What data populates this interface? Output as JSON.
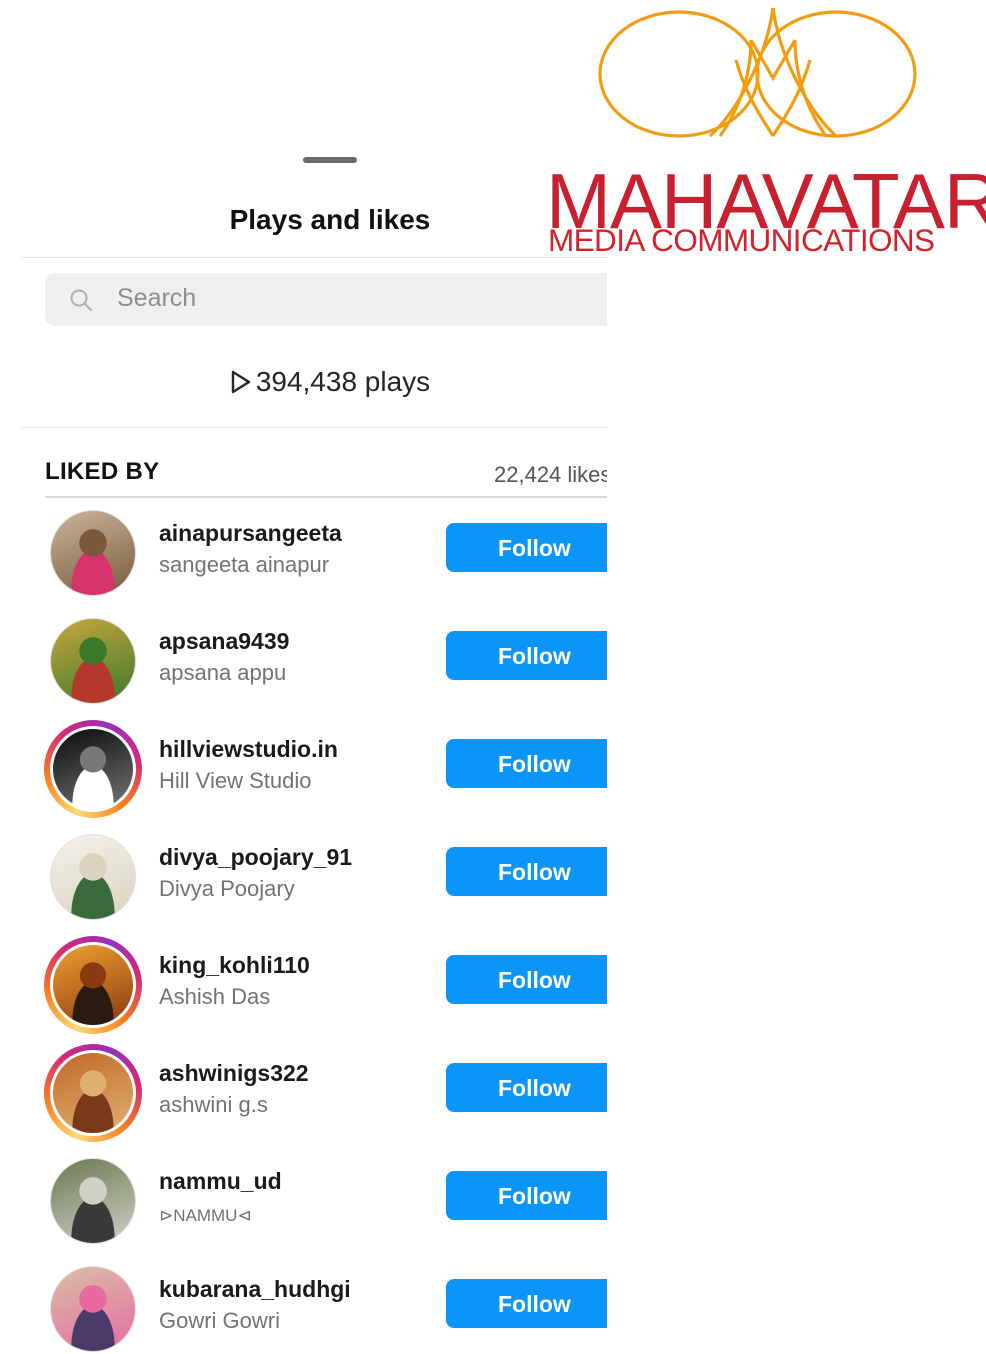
{
  "sheet": {
    "title": "Plays and likes",
    "search_placeholder": "Search",
    "plays_text": "394,438 plays",
    "liked_by_label": "LIKED BY",
    "likes_count": "22,424 likes"
  },
  "users": [
    {
      "username": "ainapursangeeta",
      "fullname": "sangeeta ainapur",
      "button": "Follow",
      "story_ring": false,
      "avatar_colors": [
        "#c9b49a",
        "#7a5a3c",
        "#d6336c"
      ]
    },
    {
      "username": "apsana9439",
      "fullname": "apsana appu",
      "button": "Follow",
      "story_ring": false,
      "avatar_colors": [
        "#c8a640",
        "#3b7a2a",
        "#b33a2a"
      ]
    },
    {
      "username": "hillviewstudio.in",
      "fullname": "Hill View Studio",
      "button": "Follow",
      "story_ring": true,
      "avatar_colors": [
        "#0a0a0a",
        "#777777",
        "#ffffff"
      ]
    },
    {
      "username": "divya_poojary_91",
      "fullname": "Divya Poojary",
      "button": "Follow",
      "story_ring": false,
      "avatar_colors": [
        "#f4f1ea",
        "#d9d3c0",
        "#3a6b3a"
      ]
    },
    {
      "username": "king_kohli110",
      "fullname": "Ashish Das",
      "button": "Follow",
      "story_ring": true,
      "avatar_colors": [
        "#f0a030",
        "#8a3a10",
        "#2a1a10"
      ]
    },
    {
      "username": "ashwinigs322",
      "fullname": "ashwini g.s",
      "button": "Follow",
      "story_ring": true,
      "avatar_colors": [
        "#c06a2a",
        "#e0b070",
        "#7a3a1a"
      ]
    },
    {
      "username": "nammu_ud",
      "fullname": "⊳NAMMU⊲",
      "button": "Follow",
      "story_ring": false,
      "avatar_colors": [
        "#6a7a50",
        "#d0d0c8",
        "#3a3a3a"
      ]
    },
    {
      "username": "kubarana_hudhgi",
      "fullname": "Gowri Gowri",
      "button": "Follow",
      "story_ring": false,
      "avatar_colors": [
        "#d8c0a8",
        "#e86aa0",
        "#4a3a6a"
      ]
    }
  ],
  "watermark": {
    "brand": "MAHAVATAR",
    "tagline": "MEDIA COMMUNICATIONS",
    "primary_color": "#c8202f",
    "accent_color": "#f39c12"
  },
  "icons": {
    "search": "magnifier-icon",
    "plays": "play-triangle-icon"
  },
  "colors": {
    "follow_button": "#0b95f6",
    "muted_text": "#737373"
  }
}
